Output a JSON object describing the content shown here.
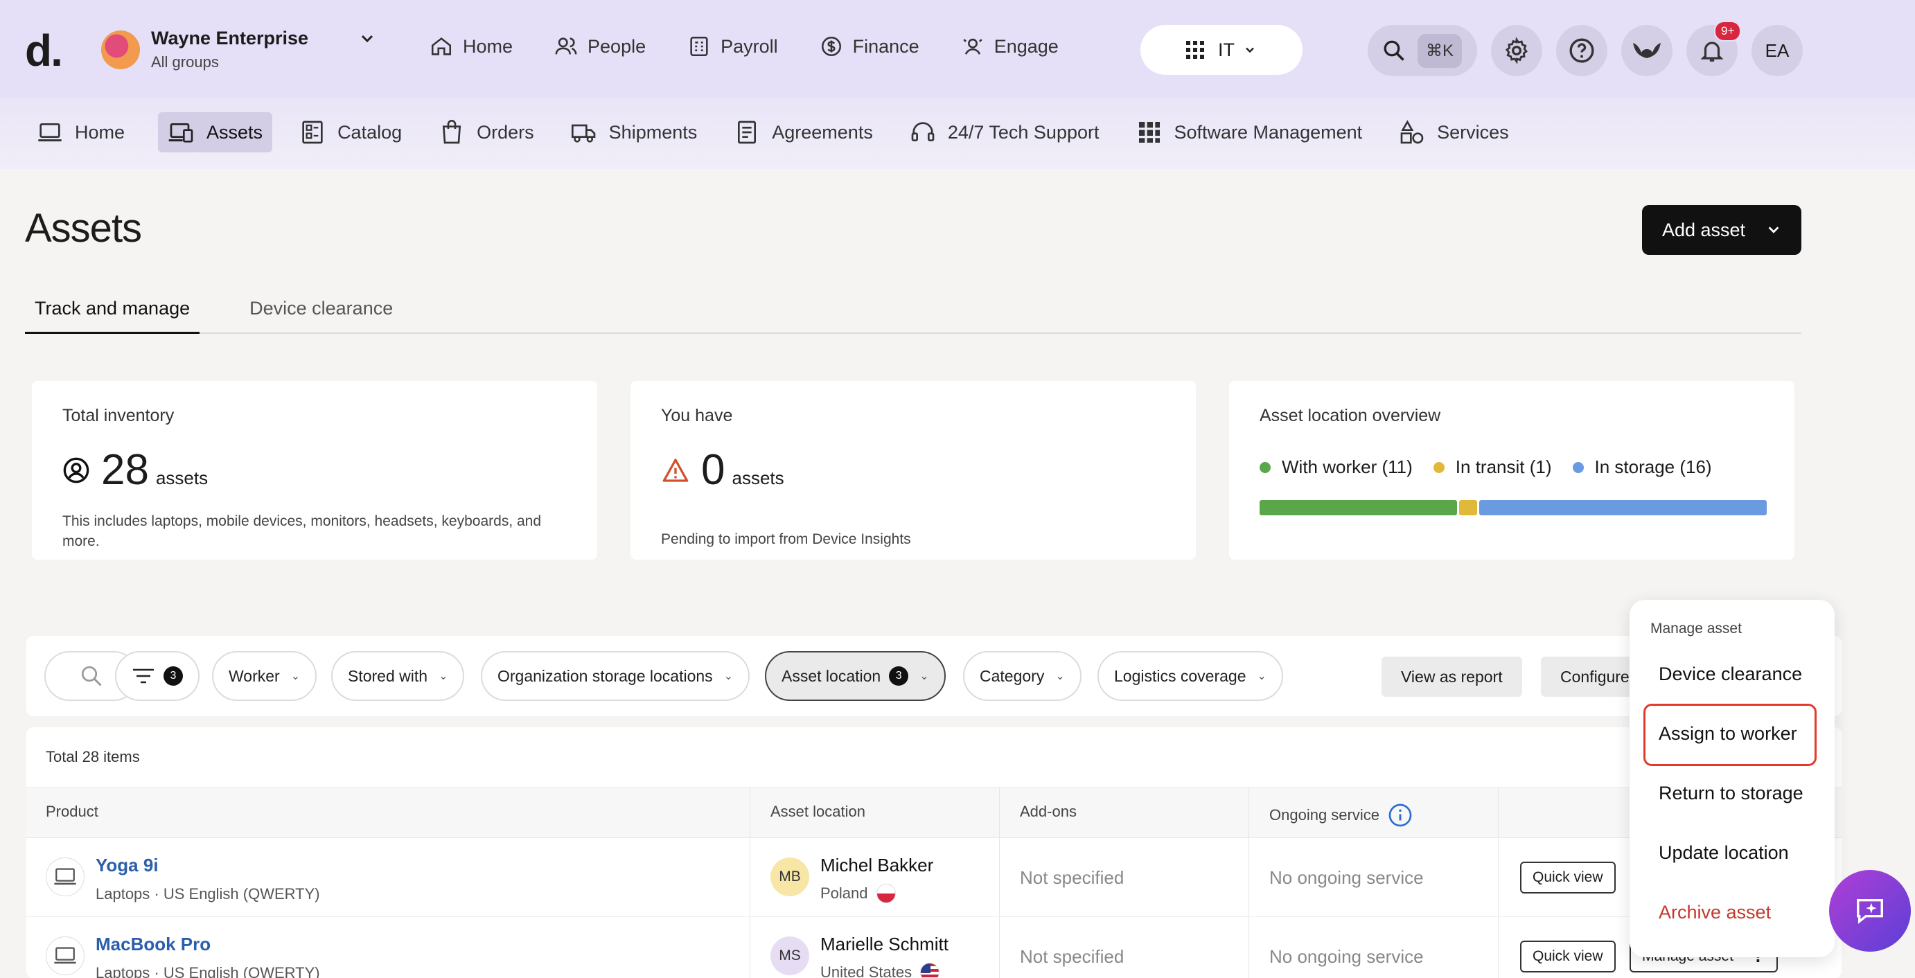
{
  "brand": {
    "logo": "d."
  },
  "org": {
    "name": "Wayne Enterprise",
    "subtitle": "All groups"
  },
  "main_nav": [
    {
      "label": "Home",
      "icon": "home-icon"
    },
    {
      "label": "People",
      "icon": "people-icon"
    },
    {
      "label": "Payroll",
      "icon": "payroll-icon"
    },
    {
      "label": "Finance",
      "icon": "finance-icon"
    },
    {
      "label": "Engage",
      "icon": "engage-icon"
    }
  ],
  "workspace_switcher": {
    "label": "IT"
  },
  "search": {
    "shortcut": "⌘K"
  },
  "notifications": {
    "badge": "9+"
  },
  "user": {
    "initials": "EA"
  },
  "sub_nav": [
    {
      "label": "Home",
      "icon": "laptop-icon",
      "active": false
    },
    {
      "label": "Assets",
      "icon": "assets-icon",
      "active": true
    },
    {
      "label": "Catalog",
      "icon": "catalog-icon",
      "active": false
    },
    {
      "label": "Orders",
      "icon": "bag-icon",
      "active": false
    },
    {
      "label": "Shipments",
      "icon": "truck-icon",
      "active": false
    },
    {
      "label": "Agreements",
      "icon": "document-icon",
      "active": false
    },
    {
      "label": "24/7 Tech Support",
      "icon": "headset-icon",
      "active": false
    },
    {
      "label": "Software Management",
      "icon": "grid-icon",
      "active": false
    },
    {
      "label": "Services",
      "icon": "services-icon",
      "active": false
    }
  ],
  "page": {
    "title": "Assets",
    "add_button": "Add asset"
  },
  "tabs": [
    {
      "label": "Track and manage",
      "active": true
    },
    {
      "label": "Device clearance",
      "active": false
    }
  ],
  "cards": {
    "inventory": {
      "title": "Total inventory",
      "value": "28",
      "unit": "assets",
      "desc": "This includes laptops, mobile devices, monitors, headsets, keyboards, and more."
    },
    "pending": {
      "title": "You have",
      "value": "0",
      "unit": "assets",
      "desc": "Pending to import from Device Insights"
    },
    "location": {
      "title": "Asset location overview",
      "legend": [
        {
          "label": "With worker (11)",
          "color": "#5aa64a",
          "count": 11
        },
        {
          "label": "In transit (1)",
          "color": "#e0b93a",
          "count": 1
        },
        {
          "label": "In storage (16)",
          "color": "#6a9be0",
          "count": 16
        }
      ]
    }
  },
  "filters": {
    "filter_count": "3",
    "chips": {
      "worker": "Worker",
      "stored_with": "Stored with",
      "org_storage": "Organization storage locations",
      "asset_location": "Asset location",
      "asset_location_count": "3",
      "category": "Category",
      "logistics": "Logistics coverage"
    },
    "view_report": "View as report",
    "configure": "Configure"
  },
  "table": {
    "total": "Total 28 items",
    "headers": {
      "product": "Product",
      "asset_location": "Asset location",
      "addons": "Add-ons",
      "ongoing": "Ongoing service"
    },
    "rows": [
      {
        "product": "Yoga 9i",
        "product_sub": "Laptops · US English (QWERTY)",
        "initials": "MB",
        "worker": "Michel Bakker",
        "country": "Poland",
        "addons": "Not specified",
        "ongoing": "No ongoing service",
        "quick_view": "Quick view",
        "manage": ""
      },
      {
        "product": "MacBook Pro",
        "product_sub": "Laptops · US English (QWERTY)",
        "initials": "MS",
        "worker": "Marielle Schmitt",
        "country": "United States",
        "addons": "Not specified",
        "ongoing": "No ongoing service",
        "quick_view": "Quick view",
        "manage": "Manage asset"
      }
    ]
  },
  "manage_menu": {
    "header": "Manage asset",
    "items": [
      "Device clearance",
      "Assign to worker",
      "Return to storage",
      "Update location",
      "Archive asset"
    ]
  }
}
